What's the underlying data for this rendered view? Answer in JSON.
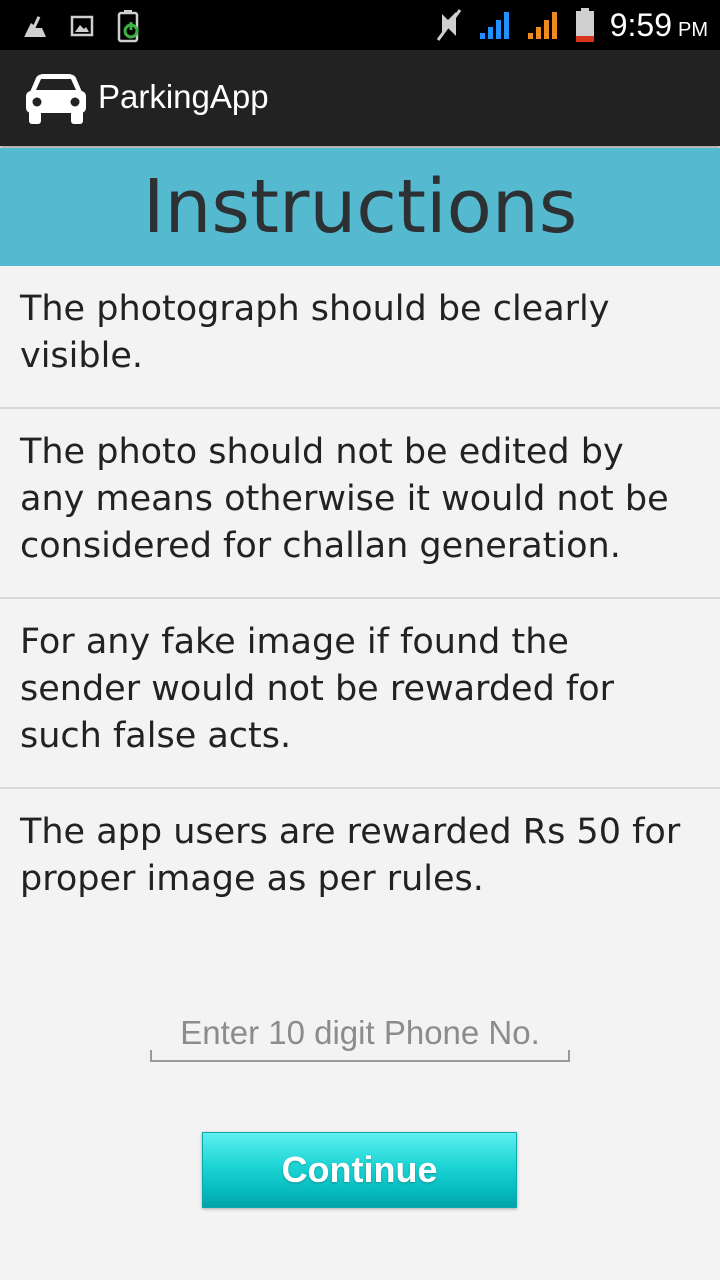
{
  "status_bar": {
    "time": "9:59",
    "ampm": "PM",
    "icons": [
      "cleaner-icon",
      "image-icon",
      "battery-saver-icon",
      "mute-icon",
      "signal-icon-1",
      "signal-icon-2",
      "battery-icon"
    ]
  },
  "app_bar": {
    "title": "ParkingApp",
    "logo_icon": "car-icon"
  },
  "heading": "Instructions",
  "instructions": [
    "The photograph should be clearly visible.",
    "The photo should  not be edited by any means otherwise it would not be considered for challan generation.",
    "For any fake image if found  the sender  would  not be rewarded  for such false acts.",
    "The app users are rewarded Rs 50 for proper image as per rules."
  ],
  "phone": {
    "value": "",
    "placeholder": "Enter 10 digit Phone No."
  },
  "continue_label": "Continue",
  "colors": {
    "heading_band": "#55bad0",
    "app_bar": "#222222",
    "button": "#1cd4d4"
  }
}
